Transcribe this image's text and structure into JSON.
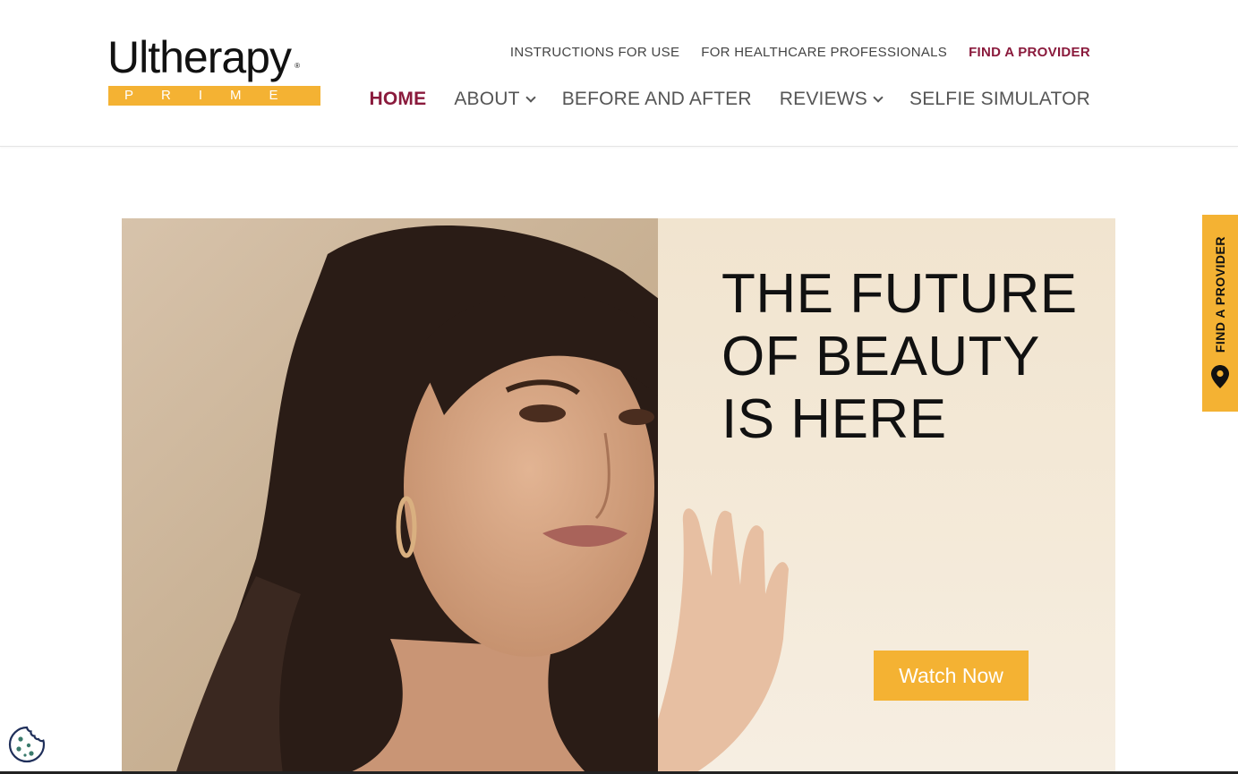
{
  "brand": {
    "logo_word": "Ultherapy",
    "logo_reg": "®",
    "logo_sub": "PRIME",
    "accent_color": "#8a1a3c",
    "gold_color": "#f4b233"
  },
  "util_nav": {
    "instructions": "INSTRUCTIONS FOR USE",
    "professionals": "FOR HEALTHCARE PROFESSIONALS",
    "find_provider": "FIND A PROVIDER"
  },
  "main_nav": {
    "home": "HOME",
    "about": "ABOUT",
    "before_after": "BEFORE AND AFTER",
    "reviews": "REVIEWS",
    "selfie": "SELFIE SIMULATOR"
  },
  "hero": {
    "title_line1": "THE FUTURE",
    "title_line2": "OF BEAUTY",
    "title_line3": "IS HERE",
    "cta": "Watch Now"
  },
  "side_tab": {
    "label": "FIND A PROVIDER",
    "icon": "map-pin-icon"
  },
  "cookie": {
    "icon": "cookie-icon"
  }
}
